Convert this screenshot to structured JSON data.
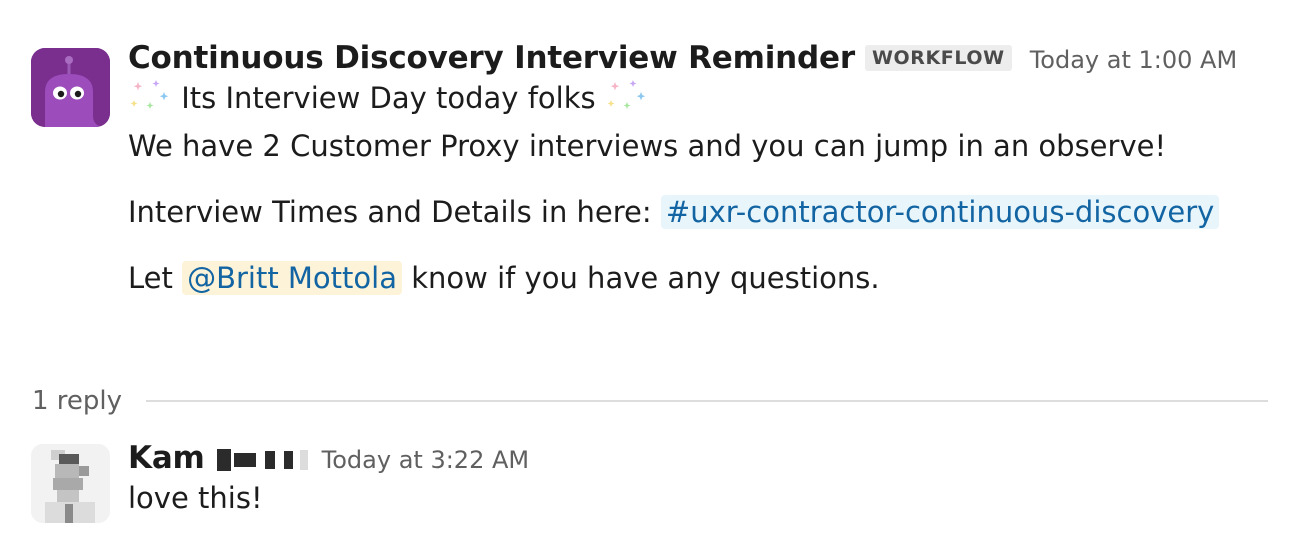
{
  "workflow_message": {
    "sender": "Continuous Discovery Interview Reminder",
    "badge": "WORKFLOW",
    "timestamp": "Today at 1:00 AM",
    "line1": "Its Interview Day today folks",
    "line2": "We have 2 Customer Proxy interviews and you can jump in an observe!",
    "details_prefix": "Interview Times and Details in here: ",
    "channel_link": "#uxr-contractor-continuous-discovery",
    "mention_prefix": "Let ",
    "mention": "@Britt Mottola",
    "mention_suffix": " know if you have any questions.",
    "avatar_color": "#7a2f8f"
  },
  "thread": {
    "reply_count": "1 reply"
  },
  "reply_message": {
    "sender": "Kam",
    "timestamp": "Today at 3:22 AM",
    "text": "love this!"
  },
  "colors": {
    "link": "#1264a3",
    "channel_bg": "#e8f5fa",
    "mention_bg": "#fdf3d8",
    "muted": "#616061"
  }
}
